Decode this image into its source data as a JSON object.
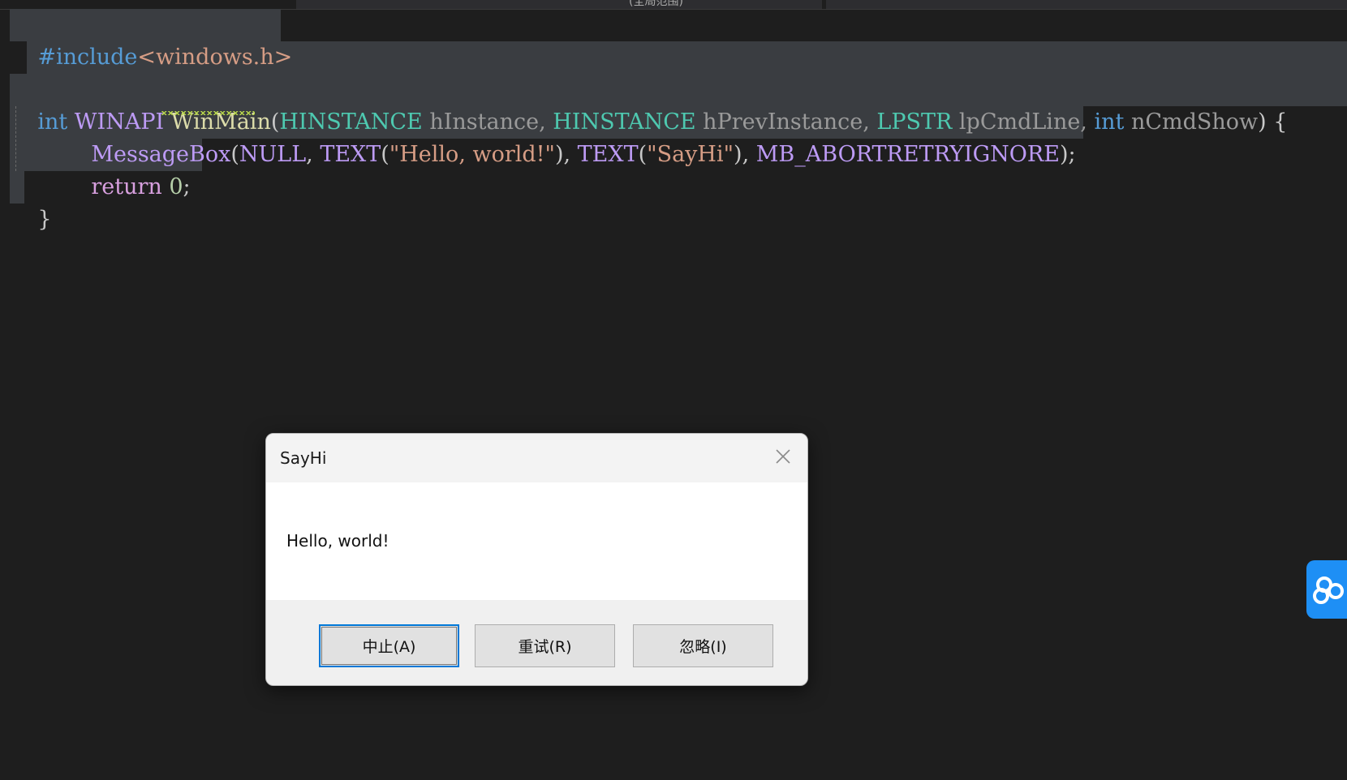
{
  "tab_strip": {
    "fragment": "(全局范围)"
  },
  "code": {
    "line1": {
      "pre": "#include",
      "header": "<windows.h>"
    },
    "line3": {
      "t1": "int",
      "t2": " WINAPI ",
      "t3": "WinMain",
      "t4": "(",
      "t5": "HINSTANCE",
      "t6": " hInstance, ",
      "t7": "HINSTANCE",
      "t8": " hPrevInstance, ",
      "t9": "LPSTR",
      "t10": " lpCmdLine, ",
      "t11": "int",
      "t12": " nCmdShow",
      "t13": ") {"
    },
    "line4": {
      "t1": "MessageBox",
      "t2": "(",
      "t3": "NULL",
      "t4": ", ",
      "t5": "TEXT",
      "t6": "(",
      "t7": "\"Hello, world!\"",
      "t8": "), ",
      "t9": "TEXT",
      "t10": "(",
      "t11": "\"SayHi\"",
      "t12": "), ",
      "t13": "MB_ABORTRETRYIGNORE",
      "t14": ");"
    },
    "line5": {
      "t1": "return",
      "t2": " ",
      "t3": "0",
      "t4": ";"
    },
    "line6": {
      "t1": "}"
    }
  },
  "dialog": {
    "title": "SayHi",
    "message": "Hello, world!",
    "buttons": {
      "abort": "中止(A)",
      "retry": "重试(R)",
      "ignore": "忽略(I)"
    }
  },
  "colors": {
    "editor_bg": "#1e1e1e",
    "keyword": "#569cd6",
    "type": "#4ec9b0",
    "function": "#dcdcaa",
    "macro": "#bd9bf5",
    "string": "#d69d85",
    "number": "#b5cea8",
    "widget_accent": "#1e8ff5"
  },
  "icons": {
    "dialog_close": "close-icon",
    "side_widget": "cloud-link-icon"
  }
}
